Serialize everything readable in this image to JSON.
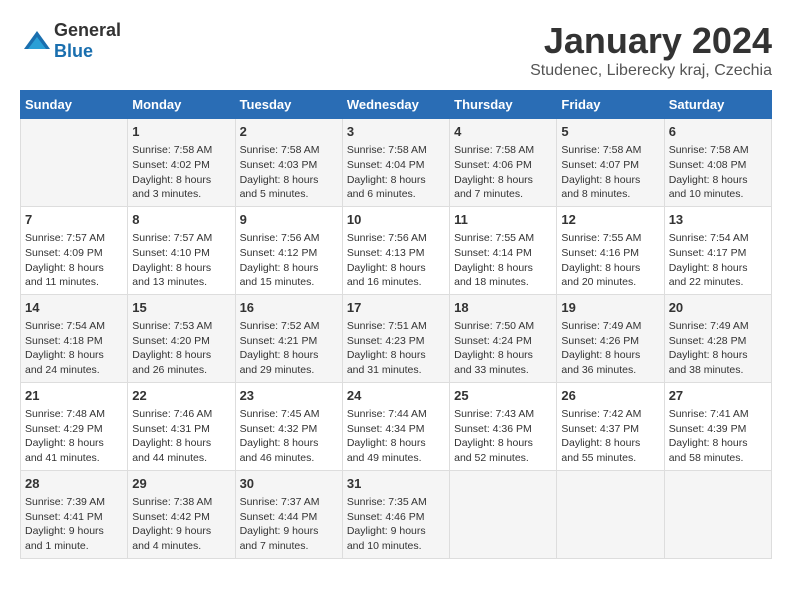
{
  "logo": {
    "general": "General",
    "blue": "Blue"
  },
  "title": "January 2024",
  "subtitle": "Studenec, Liberecky kraj, Czechia",
  "days_of_week": [
    "Sunday",
    "Monday",
    "Tuesday",
    "Wednesday",
    "Thursday",
    "Friday",
    "Saturday"
  ],
  "weeks": [
    [
      {
        "day": "",
        "info": ""
      },
      {
        "day": "1",
        "info": "Sunrise: 7:58 AM\nSunset: 4:02 PM\nDaylight: 8 hours\nand 3 minutes."
      },
      {
        "day": "2",
        "info": "Sunrise: 7:58 AM\nSunset: 4:03 PM\nDaylight: 8 hours\nand 5 minutes."
      },
      {
        "day": "3",
        "info": "Sunrise: 7:58 AM\nSunset: 4:04 PM\nDaylight: 8 hours\nand 6 minutes."
      },
      {
        "day": "4",
        "info": "Sunrise: 7:58 AM\nSunset: 4:06 PM\nDaylight: 8 hours\nand 7 minutes."
      },
      {
        "day": "5",
        "info": "Sunrise: 7:58 AM\nSunset: 4:07 PM\nDaylight: 8 hours\nand 8 minutes."
      },
      {
        "day": "6",
        "info": "Sunrise: 7:58 AM\nSunset: 4:08 PM\nDaylight: 8 hours\nand 10 minutes."
      }
    ],
    [
      {
        "day": "7",
        "info": "Sunrise: 7:57 AM\nSunset: 4:09 PM\nDaylight: 8 hours\nand 11 minutes."
      },
      {
        "day": "8",
        "info": "Sunrise: 7:57 AM\nSunset: 4:10 PM\nDaylight: 8 hours\nand 13 minutes."
      },
      {
        "day": "9",
        "info": "Sunrise: 7:56 AM\nSunset: 4:12 PM\nDaylight: 8 hours\nand 15 minutes."
      },
      {
        "day": "10",
        "info": "Sunrise: 7:56 AM\nSunset: 4:13 PM\nDaylight: 8 hours\nand 16 minutes."
      },
      {
        "day": "11",
        "info": "Sunrise: 7:55 AM\nSunset: 4:14 PM\nDaylight: 8 hours\nand 18 minutes."
      },
      {
        "day": "12",
        "info": "Sunrise: 7:55 AM\nSunset: 4:16 PM\nDaylight: 8 hours\nand 20 minutes."
      },
      {
        "day": "13",
        "info": "Sunrise: 7:54 AM\nSunset: 4:17 PM\nDaylight: 8 hours\nand 22 minutes."
      }
    ],
    [
      {
        "day": "14",
        "info": "Sunrise: 7:54 AM\nSunset: 4:18 PM\nDaylight: 8 hours\nand 24 minutes."
      },
      {
        "day": "15",
        "info": "Sunrise: 7:53 AM\nSunset: 4:20 PM\nDaylight: 8 hours\nand 26 minutes."
      },
      {
        "day": "16",
        "info": "Sunrise: 7:52 AM\nSunset: 4:21 PM\nDaylight: 8 hours\nand 29 minutes."
      },
      {
        "day": "17",
        "info": "Sunrise: 7:51 AM\nSunset: 4:23 PM\nDaylight: 8 hours\nand 31 minutes."
      },
      {
        "day": "18",
        "info": "Sunrise: 7:50 AM\nSunset: 4:24 PM\nDaylight: 8 hours\nand 33 minutes."
      },
      {
        "day": "19",
        "info": "Sunrise: 7:49 AM\nSunset: 4:26 PM\nDaylight: 8 hours\nand 36 minutes."
      },
      {
        "day": "20",
        "info": "Sunrise: 7:49 AM\nSunset: 4:28 PM\nDaylight: 8 hours\nand 38 minutes."
      }
    ],
    [
      {
        "day": "21",
        "info": "Sunrise: 7:48 AM\nSunset: 4:29 PM\nDaylight: 8 hours\nand 41 minutes."
      },
      {
        "day": "22",
        "info": "Sunrise: 7:46 AM\nSunset: 4:31 PM\nDaylight: 8 hours\nand 44 minutes."
      },
      {
        "day": "23",
        "info": "Sunrise: 7:45 AM\nSunset: 4:32 PM\nDaylight: 8 hours\nand 46 minutes."
      },
      {
        "day": "24",
        "info": "Sunrise: 7:44 AM\nSunset: 4:34 PM\nDaylight: 8 hours\nand 49 minutes."
      },
      {
        "day": "25",
        "info": "Sunrise: 7:43 AM\nSunset: 4:36 PM\nDaylight: 8 hours\nand 52 minutes."
      },
      {
        "day": "26",
        "info": "Sunrise: 7:42 AM\nSunset: 4:37 PM\nDaylight: 8 hours\nand 55 minutes."
      },
      {
        "day": "27",
        "info": "Sunrise: 7:41 AM\nSunset: 4:39 PM\nDaylight: 8 hours\nand 58 minutes."
      }
    ],
    [
      {
        "day": "28",
        "info": "Sunrise: 7:39 AM\nSunset: 4:41 PM\nDaylight: 9 hours\nand 1 minute."
      },
      {
        "day": "29",
        "info": "Sunrise: 7:38 AM\nSunset: 4:42 PM\nDaylight: 9 hours\nand 4 minutes."
      },
      {
        "day": "30",
        "info": "Sunrise: 7:37 AM\nSunset: 4:44 PM\nDaylight: 9 hours\nand 7 minutes."
      },
      {
        "day": "31",
        "info": "Sunrise: 7:35 AM\nSunset: 4:46 PM\nDaylight: 9 hours\nand 10 minutes."
      },
      {
        "day": "",
        "info": ""
      },
      {
        "day": "",
        "info": ""
      },
      {
        "day": "",
        "info": ""
      }
    ]
  ]
}
